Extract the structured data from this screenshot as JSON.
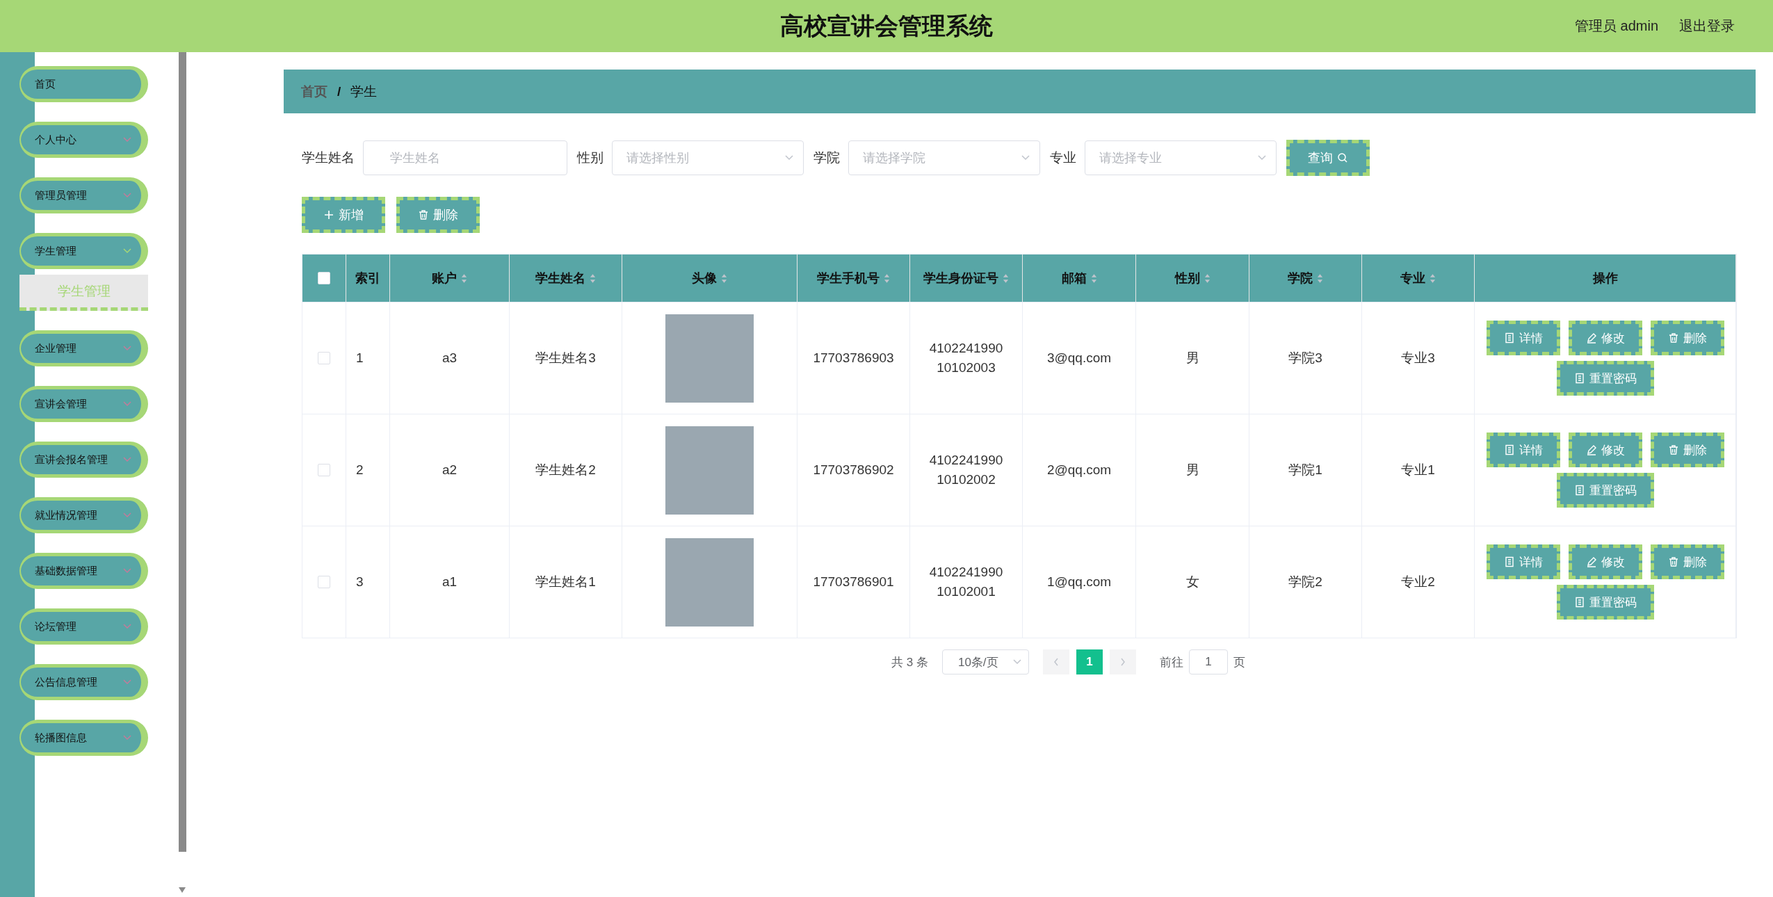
{
  "header": {
    "title": "高校宣讲会管理系统",
    "user_label": "管理员 admin",
    "logout": "退出登录"
  },
  "sidebar": {
    "items": [
      {
        "label": "首页",
        "expandable": false
      },
      {
        "label": "个人中心",
        "expandable": true,
        "expanded": false
      },
      {
        "label": "管理员管理",
        "expandable": true,
        "expanded": false
      },
      {
        "label": "学生管理",
        "expandable": true,
        "expanded": true,
        "children": [
          {
            "label": "学生管理",
            "selected": true
          }
        ]
      },
      {
        "label": "企业管理",
        "expandable": true,
        "expanded": false
      },
      {
        "label": "宣讲会管理",
        "expandable": true,
        "expanded": false
      },
      {
        "label": "宣讲会报名管理",
        "expandable": true,
        "expanded": false
      },
      {
        "label": "就业情况管理",
        "expandable": true,
        "expanded": false
      },
      {
        "label": "基础数据管理",
        "expandable": true,
        "expanded": false
      },
      {
        "label": "论坛管理",
        "expandable": true,
        "expanded": false
      },
      {
        "label": "公告信息管理",
        "expandable": true,
        "expanded": false
      },
      {
        "label": "轮播图信息",
        "expandable": true,
        "expanded": false
      }
    ]
  },
  "breadcrumb": {
    "items": [
      "首页",
      "学生"
    ],
    "separator": "/"
  },
  "filters": [
    {
      "label": "学生姓名",
      "kind": "input",
      "placeholder": "学生姓名"
    },
    {
      "label": "性别",
      "kind": "select",
      "placeholder": "请选择性别"
    },
    {
      "label": "学院",
      "kind": "select",
      "placeholder": "请选择学院"
    },
    {
      "label": "专业",
      "kind": "select",
      "placeholder": "请选择专业"
    }
  ],
  "search_button": "查询",
  "actions": [
    {
      "label": "新增",
      "kind": "add"
    },
    {
      "label": "删除",
      "kind": "delete"
    }
  ],
  "table": {
    "header_checkbox": {
      "checked": false
    },
    "columns": [
      {
        "label": "索引",
        "sortable": false
      },
      {
        "label": "账户",
        "sortable": true
      },
      {
        "label": "学生姓名",
        "sortable": true
      },
      {
        "label": "头像",
        "sortable": true
      },
      {
        "label": "学生手机号",
        "sortable": true
      },
      {
        "label": "学生身份证号",
        "sortable": true
      },
      {
        "label": "邮箱",
        "sortable": true
      },
      {
        "label": "性别",
        "sortable": true
      },
      {
        "label": "学院",
        "sortable": true
      },
      {
        "label": "专业",
        "sortable": true
      },
      {
        "label": "操作",
        "sortable": false
      }
    ],
    "rows": [
      {
        "selected": false,
        "index": "1",
        "account": "a3",
        "name": "学生姓名3",
        "phone": "17703786903",
        "id_number": "410224199010102003",
        "email": "3@qq.com",
        "gender": "男",
        "college": "学院3",
        "major": "专业3",
        "actions": [
          {
            "label": "详情",
            "kind": "detail"
          },
          {
            "label": "修改",
            "kind": "edit"
          },
          {
            "label": "删除",
            "kind": "delete"
          },
          {
            "label": "重置密码",
            "kind": "detail"
          }
        ]
      },
      {
        "selected": false,
        "index": "2",
        "account": "a2",
        "name": "学生姓名2",
        "phone": "17703786902",
        "id_number": "410224199010102002",
        "email": "2@qq.com",
        "gender": "男",
        "college": "学院1",
        "major": "专业1",
        "actions": [
          {
            "label": "详情",
            "kind": "detail"
          },
          {
            "label": "修改",
            "kind": "edit"
          },
          {
            "label": "删除",
            "kind": "delete"
          },
          {
            "label": "重置密码",
            "kind": "detail"
          }
        ]
      },
      {
        "selected": false,
        "index": "3",
        "account": "a1",
        "name": "学生姓名1",
        "phone": "17703786901",
        "id_number": "410224199010102001",
        "email": "1@qq.com",
        "gender": "女",
        "college": "学院2",
        "major": "专业2",
        "actions": [
          {
            "label": "详情",
            "kind": "detail"
          },
          {
            "label": "修改",
            "kind": "edit"
          },
          {
            "label": "删除",
            "kind": "delete"
          },
          {
            "label": "重置密码",
            "kind": "detail"
          }
        ]
      }
    ]
  },
  "pagination": {
    "total": "共 3 条",
    "page_size": "10条/页",
    "pages": [
      {
        "label": "1",
        "selected": true
      }
    ],
    "goto_label": "前往",
    "goto_value": "1",
    "page_suffix": "页"
  }
}
